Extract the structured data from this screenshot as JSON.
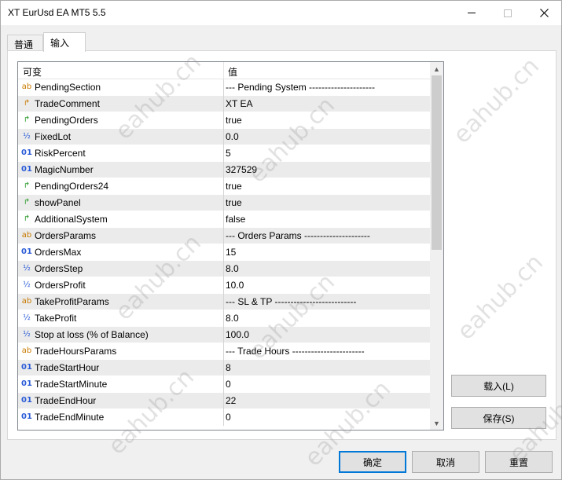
{
  "window": {
    "title": "XT EurUsd EA MT5 5.5"
  },
  "tabs": [
    {
      "label": "普通"
    },
    {
      "label": "输入"
    }
  ],
  "grid": {
    "headers": {
      "variable": "可变",
      "value": "值"
    },
    "rows": [
      {
        "icon": "ab",
        "type": "string",
        "name": "PendingSection",
        "value": "--- Pending System ---------------------"
      },
      {
        "icon": "↱",
        "type": "string",
        "name": "TradeComment",
        "value": "XT EA"
      },
      {
        "icon": "↱",
        "type": "bool",
        "name": "PendingOrders",
        "value": "true"
      },
      {
        "icon": "½",
        "type": "double",
        "name": "FixedLot",
        "value": "0.0"
      },
      {
        "icon": "01",
        "type": "int",
        "name": "RiskPercent",
        "value": "5"
      },
      {
        "icon": "01",
        "type": "int",
        "name": "MagicNumber",
        "value": "327529"
      },
      {
        "icon": "↱",
        "type": "bool",
        "name": "PendingOrders24",
        "value": "true"
      },
      {
        "icon": "↱",
        "type": "bool",
        "name": "showPanel",
        "value": "true"
      },
      {
        "icon": "↱",
        "type": "bool",
        "name": "AdditionalSystem",
        "value": "false"
      },
      {
        "icon": "ab",
        "type": "string",
        "name": "OrdersParams",
        "value": "--- Orders Params ---------------------"
      },
      {
        "icon": "01",
        "type": "int",
        "name": "OrdersMax",
        "value": "15"
      },
      {
        "icon": "½",
        "type": "double",
        "name": "OrdersStep",
        "value": "8.0"
      },
      {
        "icon": "½",
        "type": "double",
        "name": "OrdersProfit",
        "value": "10.0"
      },
      {
        "icon": "ab",
        "type": "string",
        "name": "TakeProfitParams",
        "value": "--- SL & TP --------------------------"
      },
      {
        "icon": "½",
        "type": "double",
        "name": "TakeProfit",
        "value": "8.0"
      },
      {
        "icon": "½",
        "type": "double",
        "name": "Stop at loss (% of Balance)",
        "value": "100.0"
      },
      {
        "icon": "ab",
        "type": "string",
        "name": "TradeHoursParams",
        "value": "--- Trade Hours -----------------------"
      },
      {
        "icon": "01",
        "type": "int",
        "name": "TradeStartHour",
        "value": "8"
      },
      {
        "icon": "01",
        "type": "int",
        "name": "TradeStartMinute",
        "value": "0"
      },
      {
        "icon": "01",
        "type": "int",
        "name": "TradeEndHour",
        "value": "22"
      },
      {
        "icon": "01",
        "type": "int",
        "name": "TradeEndMinute",
        "value": "0"
      }
    ]
  },
  "buttons": {
    "load": "载入(L)",
    "save": "保存(S)",
    "ok": "确定",
    "cancel": "取消",
    "reset": "重置"
  },
  "watermark": "eahub.cn",
  "colors": {
    "string_icon": "#c87a00",
    "bool_icon": "#2e9b2e",
    "number_icon": "#2a5bd7",
    "focus_border": "#0078d7",
    "alt_row": "#ebebeb"
  }
}
